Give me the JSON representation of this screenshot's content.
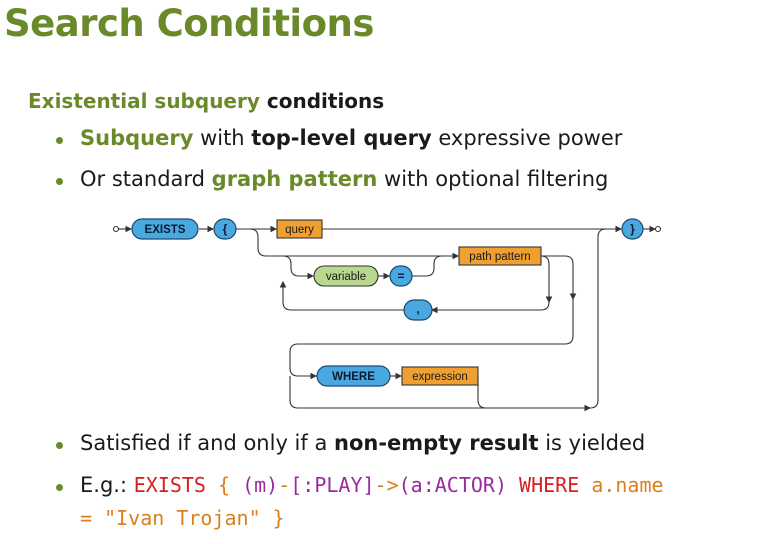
{
  "title": "Search Conditions",
  "subheading": {
    "part1": "Existential subquery",
    "part2": "conditions"
  },
  "bullets": [
    {
      "a": "Subquery",
      "b": " with ",
      "c": "top-level query",
      "d": " expressive power"
    },
    {
      "a": "Or standard ",
      "b": "graph pattern",
      "c": " with optional filtering"
    },
    {
      "a": "Satisfied if and only if a ",
      "b": "non-empty result",
      "c": " is yielded"
    }
  ],
  "example": {
    "prefix": "E.g.: ",
    "t1": "EXISTS",
    "t2": " { ",
    "t3": "(m)",
    "t4": "-",
    "t5": "[:PLAY]",
    "t6": "->",
    "t7": "(a:ACTOR)",
    "t8": " WHERE ",
    "t9": "a.name",
    "t10": "=",
    "t11": " \"Ivan Trojan\" ",
    "t12": "}"
  },
  "diagram": {
    "exists": "EXISTS",
    "lbrace": "{",
    "query": "query",
    "rbrace": "}",
    "variable": "variable",
    "equals": "=",
    "path_pattern": "path pattern",
    "comma": ",",
    "where": "WHERE",
    "expression": "expression"
  },
  "colors": {
    "accent_green": "#6a8a2a",
    "terminal_blue": "#4aa8e0",
    "nonterminal_orange": "#f0a030",
    "variable_green": "#b8d890",
    "keyword_red": "#d42020",
    "purple": "#9a2aa0"
  }
}
